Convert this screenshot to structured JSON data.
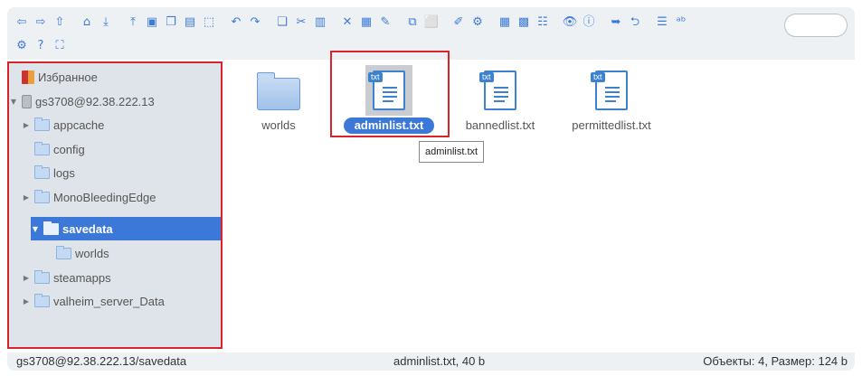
{
  "toolbar": {
    "row1": [
      "back-icon",
      "forward-icon",
      "up-icon",
      "home-icon",
      "download-icon",
      "upload-icon",
      "save-icon",
      "copy-doc-icon",
      "save-alt-icon",
      "select-icon",
      "undo-icon",
      "redo-icon",
      "copy-icon",
      "cut-icon",
      "paste-icon",
      "delete-icon",
      "clear-icon",
      "rename-icon",
      "duplicate-icon",
      "select-all-icon",
      "edit-icon",
      "extract-icon",
      "icons-view-icon",
      "grid-view-icon",
      "list-view-icon",
      "preview-icon",
      "info-icon",
      "arrow-right-icon",
      "arrow-left-icon",
      "details-icon",
      "text-icon"
    ],
    "row2": [
      "settings-icon",
      "help-icon",
      "fullscreen-icon"
    ],
    "glyphs": {
      "back-icon": "⇦",
      "forward-icon": "⇨",
      "up-icon": "⇧",
      "home-icon": "⌂",
      "download-icon": "⤓",
      "upload-icon": "⤒",
      "save-icon": "▣",
      "copy-doc-icon": "❐",
      "save-alt-icon": "▤",
      "select-icon": "⬚",
      "undo-icon": "↶",
      "redo-icon": "↷",
      "copy-icon": "❏",
      "cut-icon": "✂",
      "paste-icon": "▥",
      "delete-icon": "✕",
      "clear-icon": "▦",
      "rename-icon": "✎",
      "duplicate-icon": "⧉",
      "select-all-icon": "⬜",
      "edit-icon": "✐",
      "extract-icon": "⚙",
      "icons-view-icon": "▦",
      "grid-view-icon": "▩",
      "list-view-icon": "☷",
      "preview-icon": "👁",
      "info-icon": "ⓘ",
      "arrow-right-icon": "➥",
      "arrow-left-icon": "⮌",
      "details-icon": "☰",
      "text-icon": "ᵃᵇ",
      "settings-icon": "⚙",
      "help-icon": "?",
      "fullscreen-icon": "⛶"
    },
    "search_value": ""
  },
  "tree": {
    "items": [
      {
        "label": "Избранное",
        "type": "favorites"
      },
      {
        "label": "gs3708@92.38.222.13",
        "type": "server"
      },
      {
        "label": "appcache",
        "type": "folder"
      },
      {
        "label": "config",
        "type": "folder"
      },
      {
        "label": "logs",
        "type": "folder"
      },
      {
        "label": "MonoBleedingEdge",
        "type": "folder"
      },
      {
        "label": "savedata",
        "type": "folder"
      },
      {
        "label": "worlds",
        "type": "folder"
      },
      {
        "label": "steamapps",
        "type": "folder"
      },
      {
        "label": "valheim_server_Data",
        "type": "folder"
      }
    ]
  },
  "files": [
    {
      "name": "worlds",
      "kind": "folder",
      "tag": ""
    },
    {
      "name": "adminlist.txt",
      "kind": "txt",
      "tag": "txt"
    },
    {
      "name": "bannedlist.txt",
      "kind": "txt",
      "tag": "txt"
    },
    {
      "name": "permittedlist.txt",
      "kind": "txt",
      "tag": "txt"
    }
  ],
  "tooltip": "adminlist.txt",
  "status": {
    "path": "gs3708@92.38.222.13/savedata",
    "selection": "adminlist.txt, 40 b",
    "summary": "Объекты: 4, Размер: 124 b"
  },
  "colors": {
    "accent": "#3c78d8",
    "highlight": "#d9232c",
    "toolbar_bg": "#eef1f4",
    "tree_bg": "#dfe4ea"
  }
}
